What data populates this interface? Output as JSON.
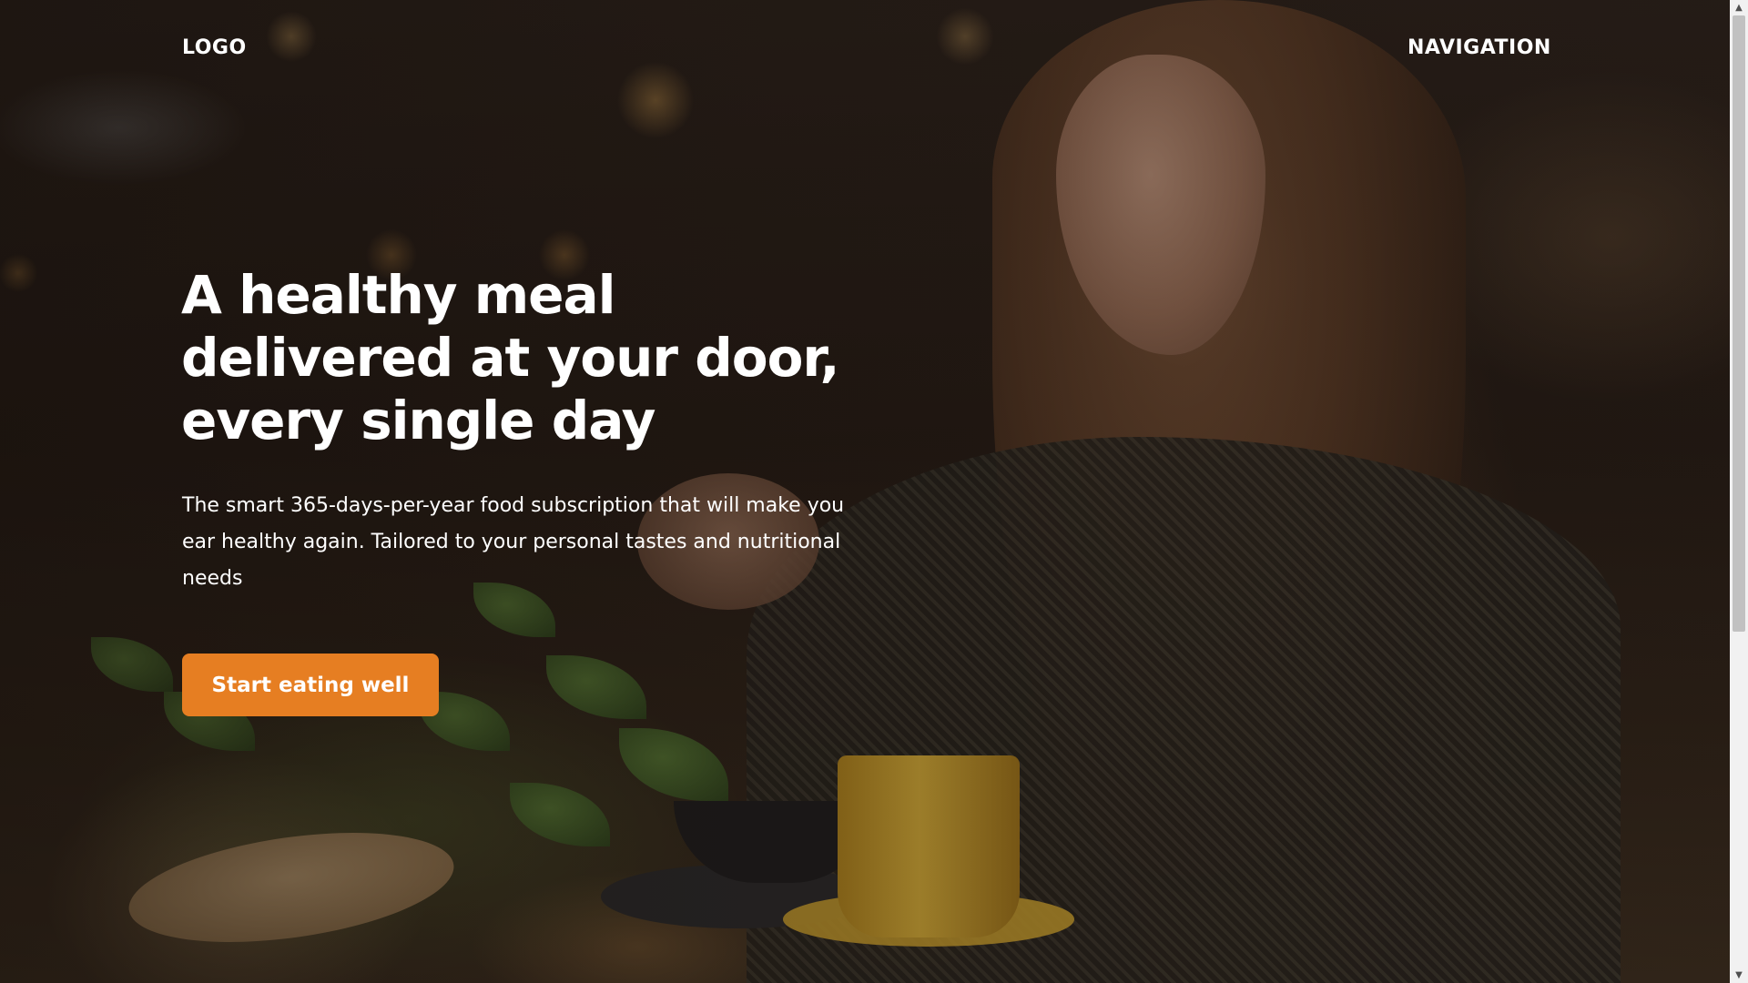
{
  "header": {
    "logo": "LOGO",
    "navigation": "NAVIGATION"
  },
  "hero": {
    "title": "A healthy meal delivered at your door, every single day",
    "description": "The smart 365-days-per-year food subscription that will make you ear healthy again. Tailored to your personal tastes and nutritional needs",
    "cta_label": "Start eating well"
  },
  "colors": {
    "accent": "#e67e22",
    "text": "#ffffff"
  },
  "scrollbar": {
    "up_icon": "chevron-up-icon",
    "down_icon": "chevron-down-icon"
  }
}
